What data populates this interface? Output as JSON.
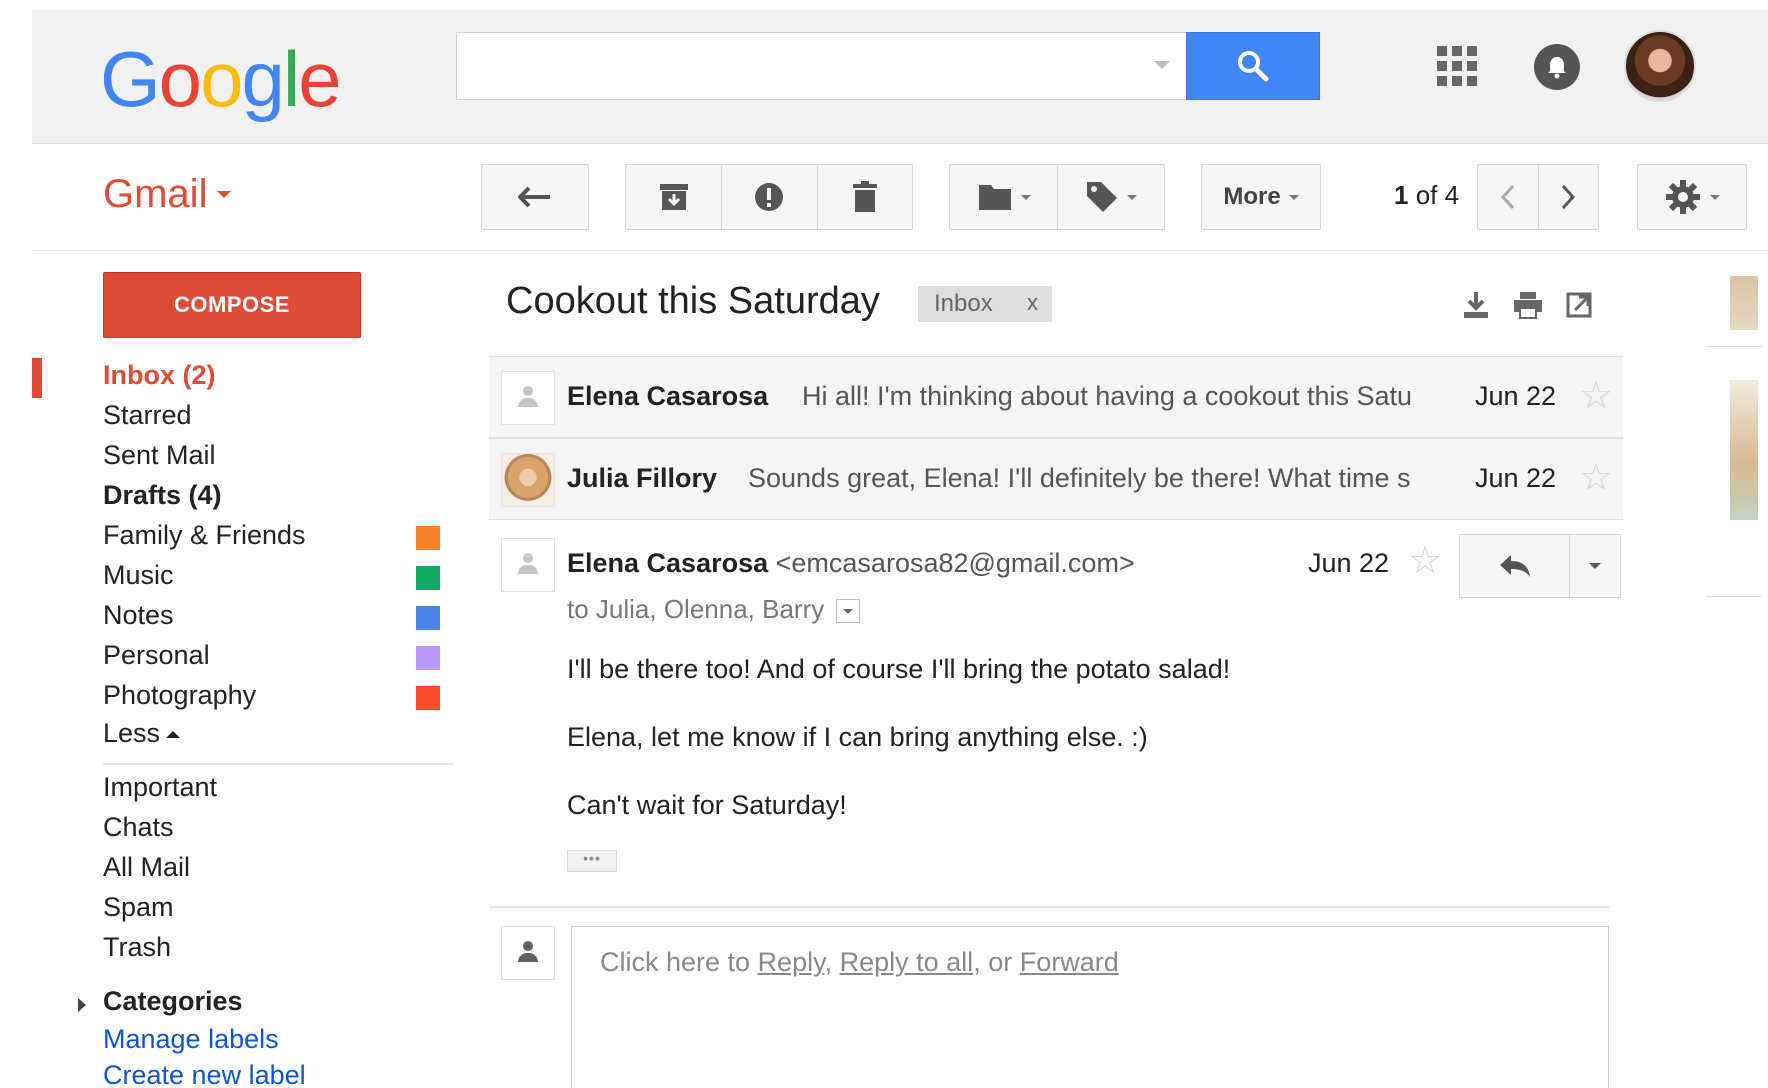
{
  "logo": {
    "text": [
      "G",
      "o",
      "o",
      "g",
      "l",
      "e"
    ],
    "colors": [
      "#4285f4",
      "#ea4335",
      "#fbbc05",
      "#4285f4",
      "#34a853",
      "#ea4335"
    ]
  },
  "search": {
    "value": "",
    "placeholder": ""
  },
  "icons": {
    "search": "magnifier-icon",
    "apps": "apps-grid-icon",
    "notifications": "bell-icon",
    "back": "back-arrow-icon",
    "archive": "archive-icon",
    "spam": "report-spam-icon",
    "delete": "trash-icon",
    "move": "folder-icon",
    "labels": "tag-icon",
    "settings": "gear-icon",
    "download": "download-icon",
    "print": "print-icon",
    "new_window": "open-new-window-icon",
    "reply": "reply-icon"
  },
  "app": {
    "name": "Gmail"
  },
  "toolbar": {
    "more_label": "More",
    "pager_current": "1",
    "pager_text": " of 4"
  },
  "sidebar": {
    "compose": "COMPOSE",
    "items": [
      {
        "label": "Inbox (2)"
      },
      {
        "label": "Starred"
      },
      {
        "label": "Sent Mail"
      },
      {
        "label": "Drafts (4)"
      },
      {
        "label": "Family & Friends",
        "color": "#f6822b"
      },
      {
        "label": "Music",
        "color": "#16a765"
      },
      {
        "label": "Notes",
        "color": "#4986e7"
      },
      {
        "label": "Personal",
        "color": "#b99aff"
      },
      {
        "label": "Photography",
        "color": "#fb4c2f"
      }
    ],
    "less": "Less",
    "system_items": [
      "Important",
      "Chats",
      "All Mail",
      "Spam",
      "Trash"
    ],
    "categories": "Categories",
    "manage_labels": "Manage labels",
    "create_label": "Create new label"
  },
  "thread": {
    "subject": "Cookout this Saturday",
    "tag": "Inbox",
    "tag_remove": "x",
    "messages": [
      {
        "sender": "Elena Casarosa",
        "snippet": "Hi all! I'm thinking about having a cookout this Satu",
        "date": "Jun 22"
      },
      {
        "sender": "Julia Fillory",
        "snippet": "Sounds great, Elena! I'll definitely be there! What time s",
        "date": "Jun 22"
      }
    ],
    "expanded": {
      "sender": "Elena Casarosa",
      "email": "<emcasarosa82@gmail.com>",
      "date": "Jun 22",
      "to": "to Julia, Olenna, Barry",
      "body": [
        "I'll be there too! And of course I'll bring the potato salad!",
        "Elena, let me know if I can bring anything else. :)",
        "Can't wait for Saturday!"
      ],
      "ellipsis": "•••"
    },
    "reply_box": {
      "prefix": "Click here to ",
      "reply": "Reply",
      "sep1": ", ",
      "reply_all": "Reply to all",
      "sep2": ", or ",
      "forward": "Forward"
    }
  },
  "accent": "#dd4b39",
  "link_color": "#1155cc"
}
